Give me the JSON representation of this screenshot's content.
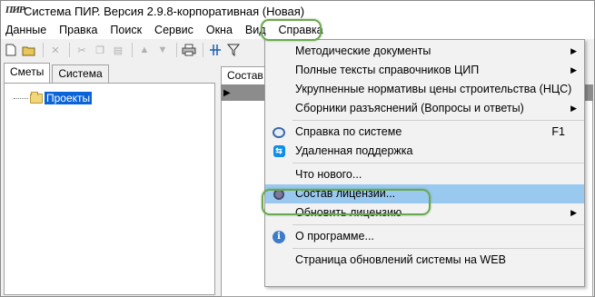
{
  "window": {
    "title": "Система ПИР. Версия 2.9.8-корпоративная (Новая)",
    "app_icon_text": "ПИР"
  },
  "menubar": {
    "items": [
      "Данные",
      "Правка",
      "Поиск",
      "Сервис",
      "Окна",
      "Вид",
      "Справка"
    ]
  },
  "toolbar": {
    "icons": [
      "new-document-icon",
      "open-folder-icon",
      "delete-icon",
      "cut-icon",
      "copy-icon",
      "paste-icon",
      "arrow-up-icon",
      "arrow-down-icon",
      "print-icon",
      "columns-icon",
      "filter-icon"
    ]
  },
  "left_panel": {
    "tabs": [
      "Сметы",
      "Система"
    ],
    "tree_item": "Проекты"
  },
  "right_panel": {
    "tab": "Состав"
  },
  "help_menu": {
    "items": [
      {
        "label": "Методические документы",
        "submenu": true
      },
      {
        "label": "Полные тексты справочников ЦИП",
        "submenu": true
      },
      {
        "label": "Укрупненные нормативы цены строительства (НЦС)"
      },
      {
        "label": "Сборники разъяснений (Вопросы и ответы)",
        "submenu": true
      },
      {
        "label": "Справка по системе",
        "shortcut": "F1",
        "icon": "help-icon"
      },
      {
        "label": "Удаленная поддержка",
        "icon": "teamviewer-icon"
      },
      {
        "label": "Что нового..."
      },
      {
        "label": "Состав лицензии...",
        "icon": "license-icon",
        "highlighted": true
      },
      {
        "label": "Обновить лицензию",
        "submenu": true
      },
      {
        "label": "О программе...",
        "icon": "info-icon"
      },
      {
        "label": "Страница обновлений системы  на WEB"
      }
    ]
  },
  "accent_colors": {
    "highlight_ring": "#6aa84f",
    "menu_hover": "#99c9ef",
    "tree_selection": "#0a64d8"
  }
}
